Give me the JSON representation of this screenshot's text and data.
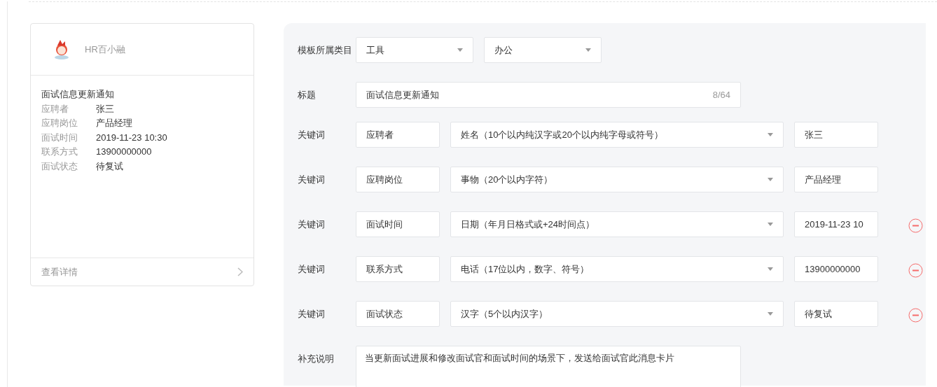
{
  "preview_card": {
    "sender": "HR百小融",
    "title": "面试信息更新通知",
    "fields": [
      {
        "label": "应聘者",
        "value": "张三"
      },
      {
        "label": "应聘岗位",
        "value": "产品经理"
      },
      {
        "label": "面试时间",
        "value": "2019-11-23 10:30"
      },
      {
        "label": "联系方式",
        "value": "13900000000"
      },
      {
        "label": "面试状态",
        "value": "待复试"
      }
    ],
    "footer_link": "查看详情"
  },
  "form": {
    "category": {
      "label": "模板所属类目",
      "selects": [
        "工具",
        "办公"
      ]
    },
    "title": {
      "label": "标题",
      "value": "面试信息更新通知",
      "counter": "8/64"
    },
    "keywords": [
      {
        "label": "关键词",
        "name": "应聘者",
        "type": "姓名（10个以内纯汉字或20个以内纯字母或符号）",
        "value": "张三",
        "removable": false
      },
      {
        "label": "关键词",
        "name": "应聘岗位",
        "type": "事物（20个以内字符）",
        "value": "产品经理",
        "removable": false
      },
      {
        "label": "关键词",
        "name": "面试时间",
        "type": "日期（年月日格式或+24时间点）",
        "value": "2019-11-23 10",
        "removable": true
      },
      {
        "label": "关键词",
        "name": "联系方式",
        "type": "电话（17位以内，数字、符号）",
        "value": "13900000000",
        "removable": true
      },
      {
        "label": "关键词",
        "name": "面试状态",
        "type": "汉字（5个以内汉字）",
        "value": "待复试",
        "removable": true
      }
    ],
    "remark": {
      "label": "补充说明",
      "value": "当更新面试进展和修改面试官和面试时间的场景下，发送给面试官此消息卡片"
    }
  }
}
